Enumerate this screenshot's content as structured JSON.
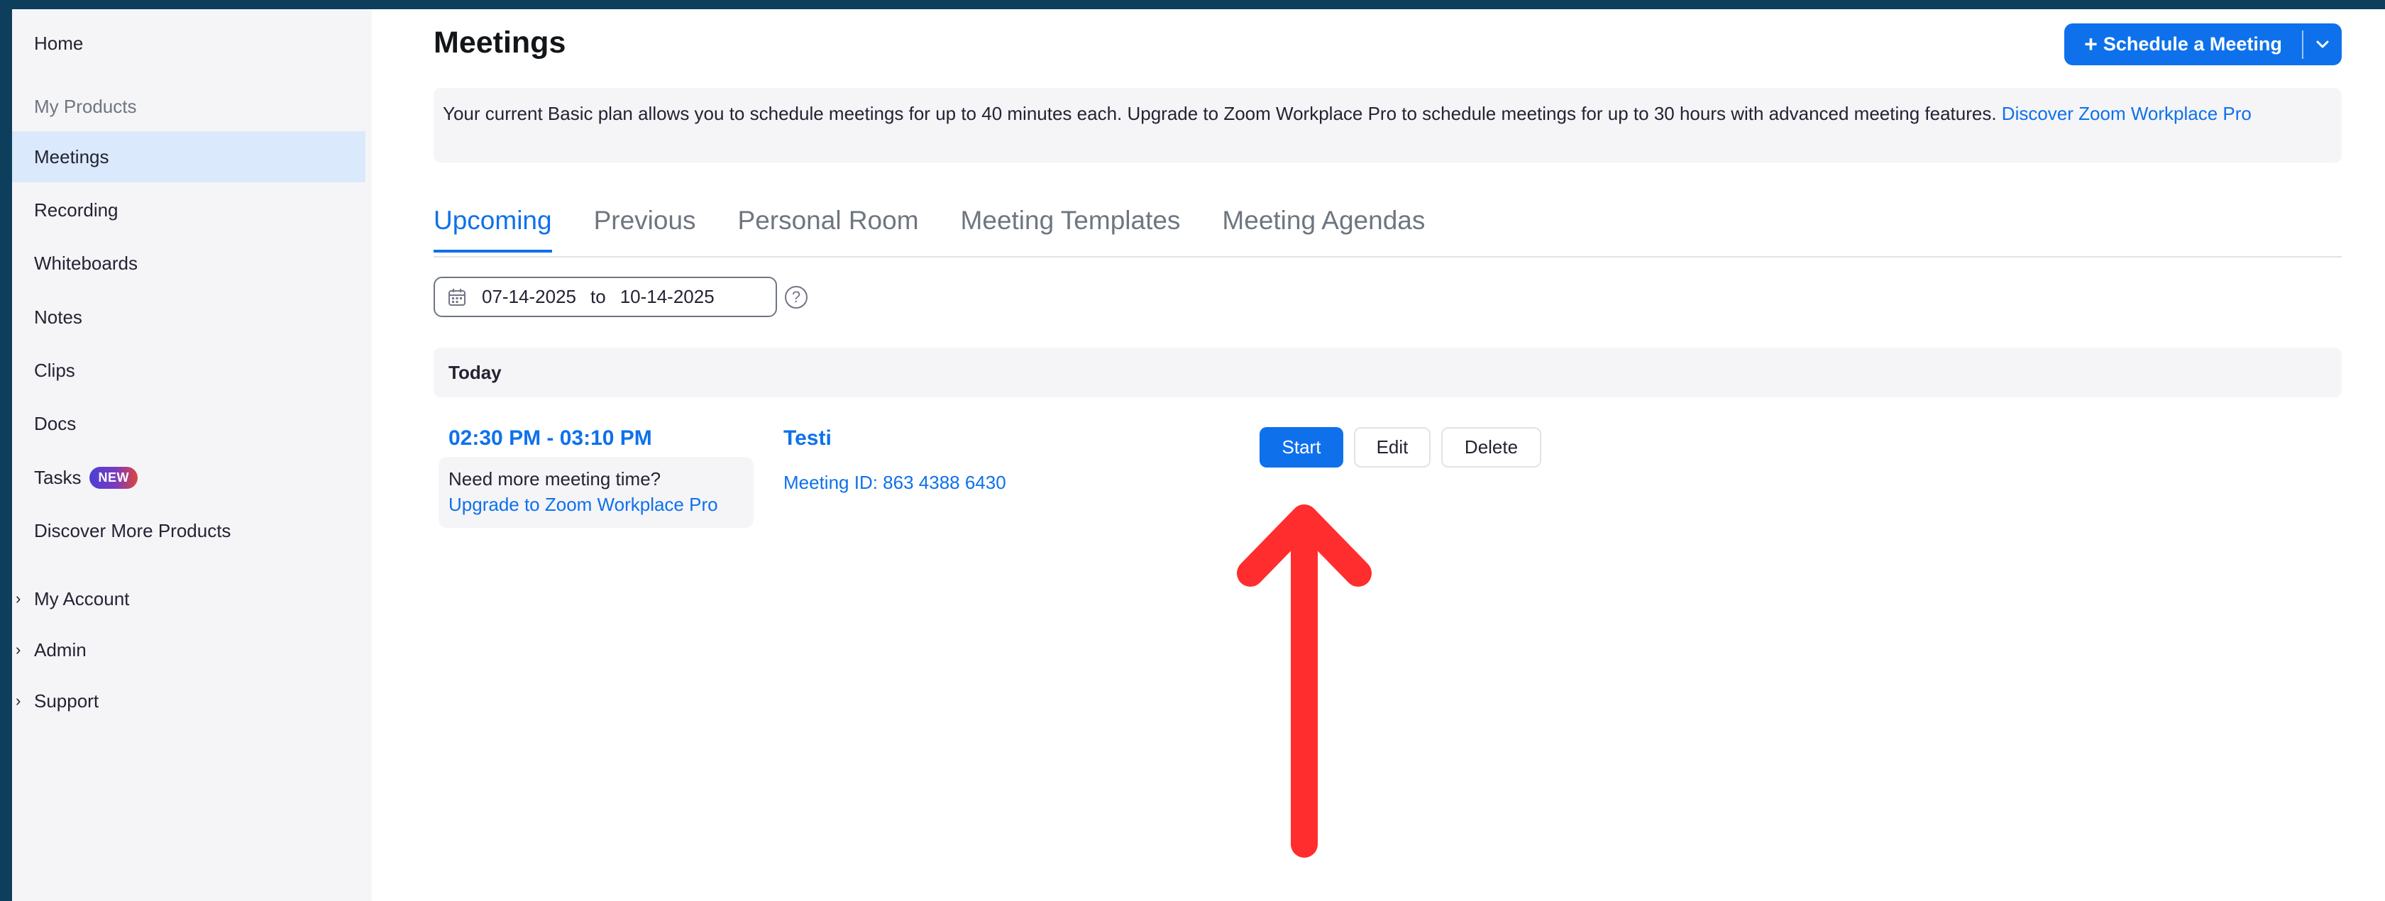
{
  "sidebar": {
    "home": "Home",
    "section_title": "My Products",
    "items": [
      {
        "label": "Meetings"
      },
      {
        "label": "Recording"
      },
      {
        "label": "Whiteboards"
      },
      {
        "label": "Notes"
      },
      {
        "label": "Clips"
      },
      {
        "label": "Docs"
      },
      {
        "label": "Tasks",
        "badge": "NEW"
      },
      {
        "label": "Discover More Products"
      }
    ],
    "groups": [
      {
        "label": "My Account"
      },
      {
        "label": "Admin"
      },
      {
        "label": "Support"
      }
    ]
  },
  "header": {
    "title": "Meetings",
    "schedule_button": "Schedule a Meeting",
    "schedule_plus": "+"
  },
  "banner": {
    "text": "Your current Basic plan allows you to schedule meetings for up to 40 minutes each. Upgrade to Zoom Workplace Pro to schedule meetings for up to 30 hours with advanced meeting features.",
    "link": "Discover Zoom Workplace Pro"
  },
  "tabs": [
    {
      "label": "Upcoming",
      "active": true
    },
    {
      "label": "Previous"
    },
    {
      "label": "Personal Room"
    },
    {
      "label": "Meeting Templates"
    },
    {
      "label": "Meeting Agendas"
    }
  ],
  "date_range": {
    "from": "07-14-2025",
    "separator": "to",
    "to": "10-14-2025"
  },
  "day_group": "Today",
  "meeting": {
    "time": "02:30 PM - 03:10 PM",
    "upsell_text": "Need more meeting time?",
    "upsell_link": "Upgrade to Zoom Workplace Pro",
    "name": "Testi",
    "meeting_id": "Meeting ID: 863 4388 6430",
    "actions": {
      "start": "Start",
      "edit": "Edit",
      "delete": "Delete"
    }
  },
  "colors": {
    "accent": "#0e71eb",
    "arrow": "#ff2d2d",
    "active_nav": "#dbe9fc"
  }
}
